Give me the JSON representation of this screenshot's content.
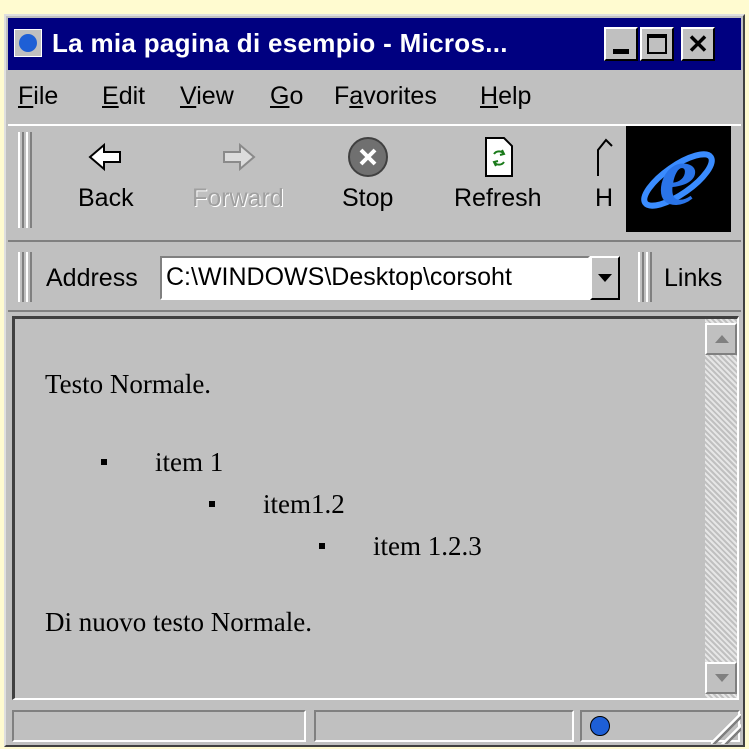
{
  "window": {
    "title": "La mia pagina di esempio - Micros...",
    "controls": {
      "minimize": "minimize",
      "maximize": "maximize",
      "close": "✕"
    }
  },
  "menu": [
    {
      "label": "File",
      "accel": "F",
      "rest": "ile"
    },
    {
      "label": "Edit",
      "accel": "E",
      "rest": "dit"
    },
    {
      "label": "View",
      "accel": "V",
      "rest": "iew"
    },
    {
      "label": "Go",
      "accel": "G",
      "rest": "o"
    },
    {
      "label": "Favorites",
      "pre": "F",
      "accel": "a",
      "rest": "vorites"
    },
    {
      "label": "Help",
      "accel": "H",
      "rest": "elp"
    }
  ],
  "toolbar": {
    "back": {
      "label": "Back",
      "icon": "back-arrow-icon"
    },
    "forward": {
      "label": "Forward",
      "icon": "forward-arrow-icon",
      "disabled": true
    },
    "stop": {
      "label": "Stop",
      "icon": "stop-icon"
    },
    "refresh": {
      "label": "Refresh",
      "icon": "refresh-icon"
    },
    "home": {
      "label": "H",
      "icon": "home-icon"
    },
    "logo": "ie-logo-icon"
  },
  "address": {
    "label": "Address",
    "value": "C:\\WINDOWS\\Desktop\\corsoht",
    "links_label": "Links"
  },
  "page": {
    "paragraph1": "Testo Normale.",
    "list": [
      {
        "text": "item 1",
        "level": 1
      },
      {
        "text": "item1.2",
        "level": 2
      },
      {
        "text": "item 1.2.3",
        "level": 3
      }
    ],
    "paragraph2": "Di nuovo testo Normale."
  },
  "status": {
    "zone_icon": "internet-zone-icon"
  },
  "colors": {
    "titlebar": "#000080",
    "face": "#c0c0c0",
    "background": "#fffbd0",
    "ie_blue": "#1e5fd6"
  }
}
